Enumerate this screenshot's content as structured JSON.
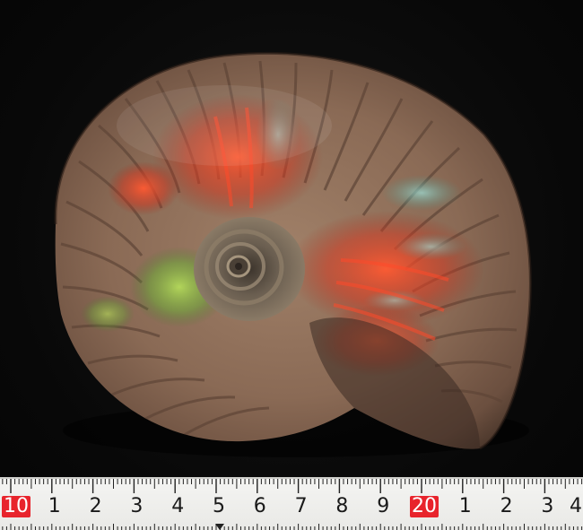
{
  "photo": {
    "subject": "ammonite-fossil",
    "background_color": "#0b0b0b",
    "shell_colors": {
      "base": "#8a6a55",
      "ribs": "#6e5343",
      "iridescent_red": "#e0432a",
      "iridescent_green": "#7fbf4a",
      "iridescent_cyan": "#7fd0c8",
      "umbilicus": "#5f5346"
    }
  },
  "ruler": {
    "labels": [
      "10",
      "1",
      "2",
      "3",
      "4",
      "5",
      "6",
      "7",
      "8",
      "9",
      "20",
      "1",
      "2",
      "3",
      "4"
    ],
    "highlighted": [
      0,
      10
    ],
    "highlight_color": "#e8242c",
    "background_color": "#f1f1ef"
  }
}
